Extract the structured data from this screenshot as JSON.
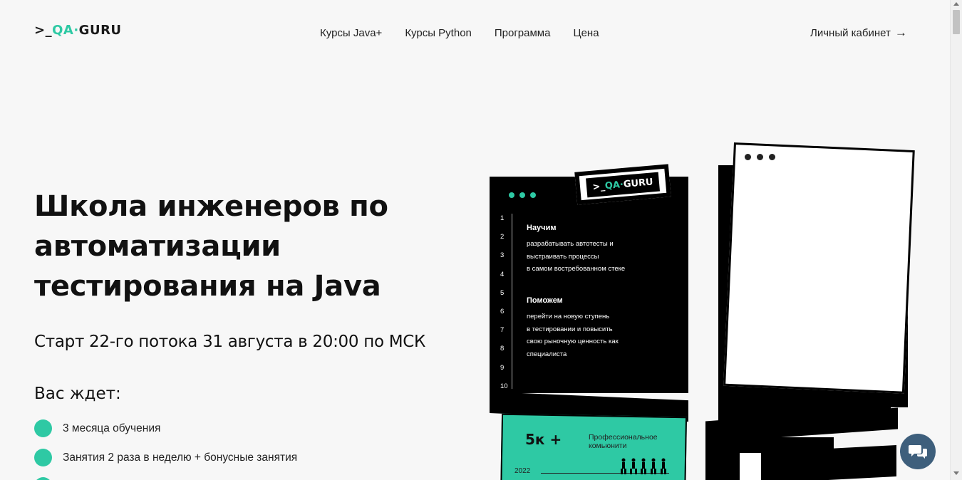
{
  "header": {
    "logo": {
      "prefix": ">_",
      "accent": "QA",
      "sep": "·",
      "suffix": "GURU"
    },
    "nav": [
      {
        "label": "Курсы Java+"
      },
      {
        "label": "Курсы Python"
      },
      {
        "label": "Программа"
      },
      {
        "label": "Цена"
      }
    ],
    "cabinet": {
      "label": "Личный кабинет",
      "arrow": "→"
    }
  },
  "hero": {
    "title": "Школа инженеров по автоматизации тестирования на Java",
    "start": "Старт 22-го потока 31 августа в 20:00 по МСК",
    "wait_title": "Вас ждет:",
    "features": [
      "3 месяца обучения",
      "Занятия 2 раза в неделю + бонусные занятия"
    ]
  },
  "illustration": {
    "badge": {
      "prefix": ">_",
      "accent": "QA",
      "sep": "·",
      "suffix": "GURU"
    },
    "line_numbers": [
      "1",
      "2",
      "3",
      "4",
      "5",
      "6",
      "7",
      "8",
      "9",
      "10"
    ],
    "block1": {
      "heading": "Научим",
      "lines": [
        "разрабатывать автотесты и",
        "выстраивать процессы",
        "в самом востребованном стеке"
      ]
    },
    "block2": {
      "heading": "Поможем",
      "lines": [
        "перейти на новую ступень",
        "в тестировании и повысить",
        "свою рыночную ценность как",
        "специалиста"
      ]
    },
    "stat": {
      "number": "5к +",
      "text_line1": "Профессиональное",
      "text_line2": "комьюнити",
      "year": "2022"
    }
  },
  "colors": {
    "accent": "#2ec9a4",
    "chat": "#3e5f7c",
    "background": "#f7f7f7"
  },
  "icons": {
    "chat": "chat-bubbles-icon",
    "arrow": "arrow-right-icon"
  }
}
